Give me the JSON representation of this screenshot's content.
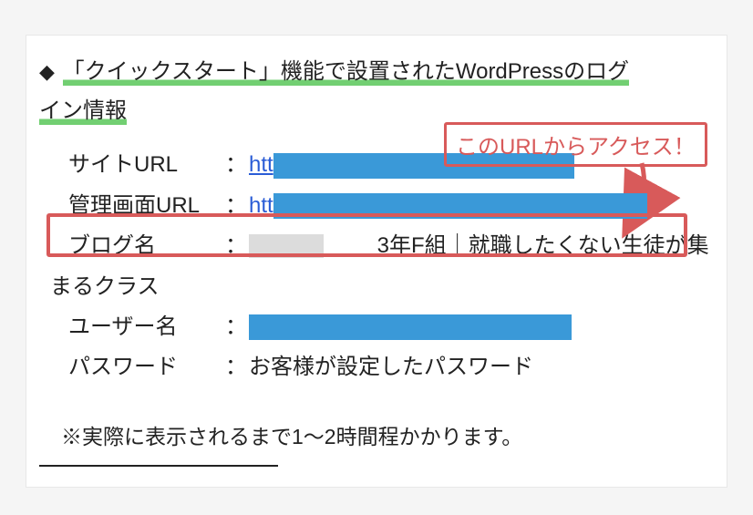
{
  "heading": {
    "diamond": "◆",
    "line1": "「クイックスタート」機能で設置されたWordPressのログ",
    "line2": "イン情報"
  },
  "callout": {
    "text": "このURLからアクセス！"
  },
  "rows": {
    "site_url": {
      "label": "サイトURL",
      "colon": "：",
      "link_text": "htt"
    },
    "admin_url": {
      "label": "管理画面URL",
      "colon": "：",
      "link_text": "htt"
    },
    "blog_name": {
      "label": "ブログ名",
      "colon": "：",
      "value_part1": " 　　3年F組｜就職したくない生徒が集",
      "value_wrap": "まるクラス"
    },
    "username": {
      "label": "ユーザー名",
      "colon": "："
    },
    "password": {
      "label": "パスワード",
      "colon": "：",
      "value": "お客様が設定したパスワード"
    }
  },
  "note": "※実際に表示されるまで1〜2時間程かかります。",
  "colors": {
    "accent_red": "#d85a5a",
    "underline_green": "#72cf72",
    "redact_blue": "#3a99d8",
    "link_blue": "#2a5cd6"
  }
}
